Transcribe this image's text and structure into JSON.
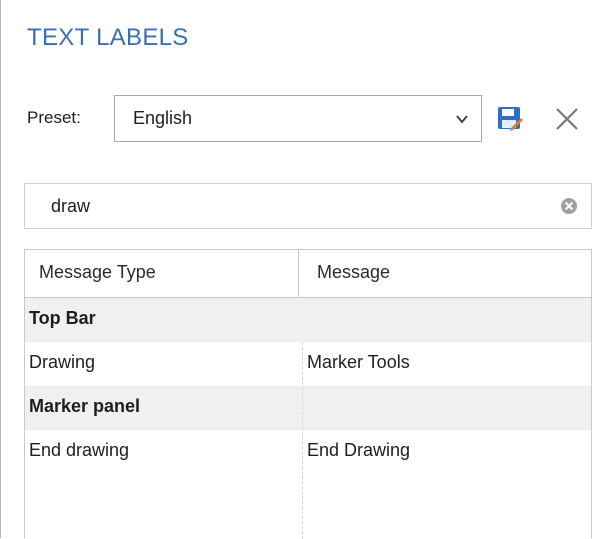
{
  "panel": {
    "title": "TEXT LABELS"
  },
  "preset": {
    "label": "Preset:",
    "selected": "English"
  },
  "search": {
    "value": "draw"
  },
  "grid": {
    "columns": [
      "Message Type",
      "Message"
    ],
    "rows": [
      {
        "type": "group",
        "label": "Top Bar"
      },
      {
        "type": "item",
        "message_type": "Drawing",
        "message": "Marker Tools"
      },
      {
        "type": "group",
        "label": "Marker panel"
      },
      {
        "type": "item",
        "message_type": "End drawing",
        "message": "End Drawing"
      }
    ]
  },
  "icons": {
    "save": "save-icon",
    "delete": "close-icon",
    "dropdown": "chevron-down-icon",
    "clear": "clear-icon"
  },
  "colors": {
    "title": "#3c6fb0",
    "save_icon": "#2f6fc4",
    "group_row_bg": "#f0f0f0"
  }
}
